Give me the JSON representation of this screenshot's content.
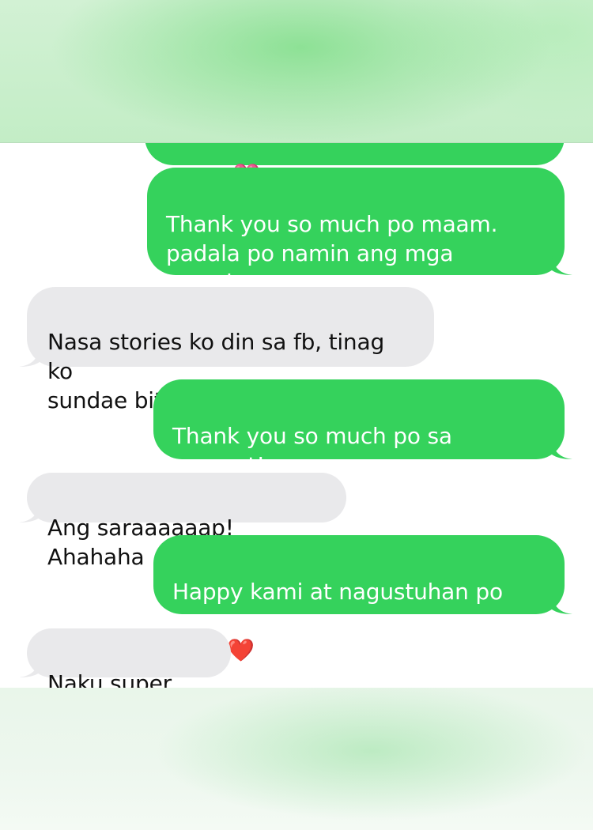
{
  "conversation": {
    "messages": [
      {
        "sender": "me",
        "text": "to you💝",
        "partial": true
      },
      {
        "sender": "me",
        "text": "Thank you so much po maam.\npadala po namin ang mga samples\nafter lunch💝💝"
      },
      {
        "sender": "them",
        "text": "Nasa stories ko din sa fb, tinag ko\nsundae bites ph :)"
      },
      {
        "sender": "me",
        "text": "Thank you so much po sa support!\n❤️❤️❤️"
      },
      {
        "sender": "them",
        "text": "Ang saraaaaaap! Ahahaha"
      },
      {
        "sender": "me",
        "text": "Happy kami at nagustuhan po nyo.\n❤️❤️❤️"
      },
      {
        "sender": "them",
        "text": "Naku super. ❤️"
      }
    ]
  },
  "colors": {
    "sent_bubble": "#35d25c",
    "received_bubble": "#e9e9eb",
    "background_green": "#c3edc6"
  }
}
